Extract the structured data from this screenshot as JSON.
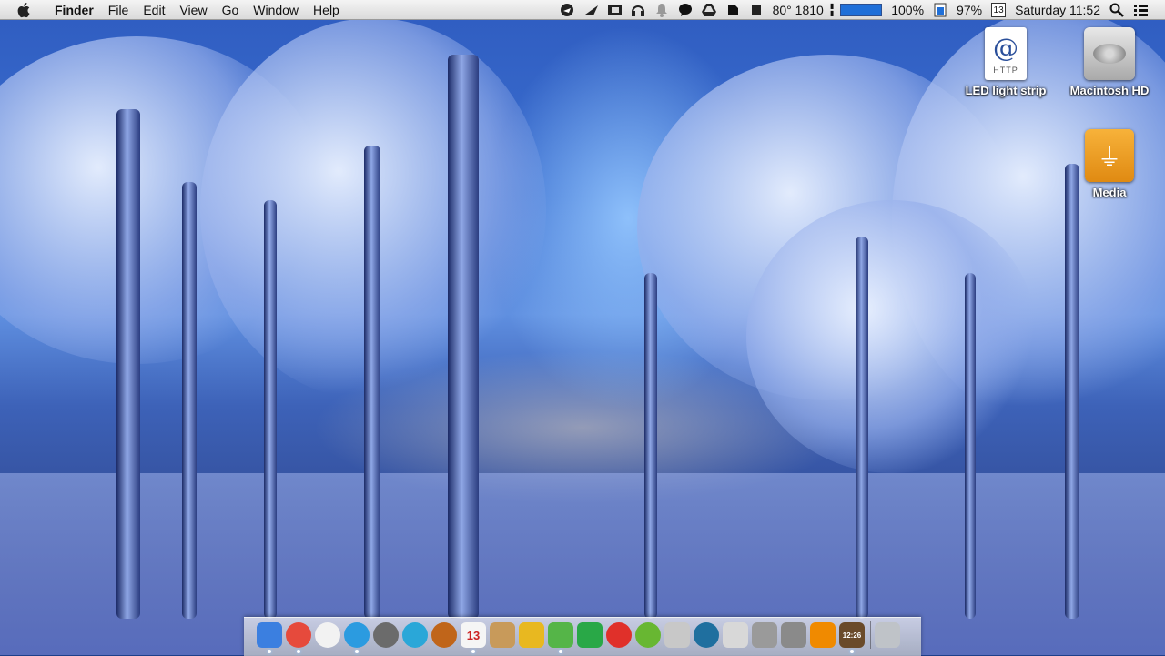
{
  "menubar": {
    "app_name": "Finder",
    "menus": [
      "File",
      "Edit",
      "View",
      "Go",
      "Window",
      "Help"
    ],
    "status": {
      "weather": "80° 1810",
      "battery_percent": "100%",
      "battery_level": 1.0,
      "memory_percent": "97%",
      "calendar_day": "13",
      "datetime": "Saturday 11:52"
    }
  },
  "desktop": {
    "icons": [
      {
        "label": "LED light strip",
        "tag": "HTTP",
        "symbol": "@"
      },
      {
        "label": "Macintosh HD"
      },
      {
        "label": "Media",
        "symbol": "⏚"
      }
    ]
  },
  "dock": {
    "calendar_day": "13",
    "clock_time": "12:26",
    "items": [
      {
        "name": "finder",
        "color": "#3b7fe0"
      },
      {
        "name": "chrome",
        "color": "#e64a3c"
      },
      {
        "name": "opera",
        "color": "#f2f2f2"
      },
      {
        "name": "safari",
        "color": "#2b9be0"
      },
      {
        "name": "launchpad",
        "color": "#6b6b6b"
      },
      {
        "name": "itunes",
        "color": "#2aa7d8"
      },
      {
        "name": "speaker",
        "color": "#c0651a"
      },
      {
        "name": "calendar",
        "color": "#f5f5f5"
      },
      {
        "name": "contacts",
        "color": "#c89a5a"
      },
      {
        "name": "wunderlist",
        "color": "#e8b820"
      },
      {
        "name": "evernote",
        "color": "#55b548"
      },
      {
        "name": "gmail",
        "color": "#29a847"
      },
      {
        "name": "podcast",
        "color": "#e0302a"
      },
      {
        "name": "utorrent",
        "color": "#68b732"
      },
      {
        "name": "calculator",
        "color": "#c8c8c8"
      },
      {
        "name": "xquartz",
        "color": "#1f6f9f"
      },
      {
        "name": "preview",
        "color": "#d8d8d8"
      },
      {
        "name": "system-info",
        "color": "#9a9a9a"
      },
      {
        "name": "system-preferences",
        "color": "#8a8a8a"
      },
      {
        "name": "vlc",
        "color": "#f08a00"
      },
      {
        "name": "clock-widget",
        "color": "#6a4a2a"
      },
      {
        "name": "trash",
        "color": "#bfc3c8"
      }
    ]
  }
}
